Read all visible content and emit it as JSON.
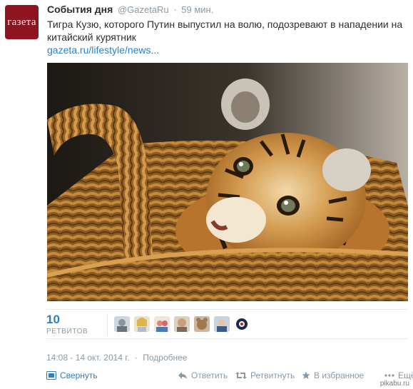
{
  "tweet": {
    "avatar_text": "газета",
    "fullname": "События дня",
    "username": "@GazetaRu",
    "time": "59 мин.",
    "text": "Тигра Кузю, которого Путин выпустил на волю, подозревают в нападении на китайский курятник",
    "link": "gazeta.ru/lifestyle/news..."
  },
  "stats": {
    "retweet_count": "10",
    "retweet_label": "РЕТВИТОВ"
  },
  "meta": {
    "timestamp": "14:08 - 14 окт. 2014 г.",
    "separator": "·",
    "details": "Подробнее"
  },
  "actions": {
    "collapse": "Свернуть",
    "reply": "Ответить",
    "retweet": "Ретвитнуть",
    "favorite": "В избранное",
    "more": "Ещё"
  },
  "watermark": "pikabu.ru",
  "colors": {
    "link": "#2a7fc7",
    "muted": "#8899a6",
    "avatar_bg": "#8e1420"
  }
}
